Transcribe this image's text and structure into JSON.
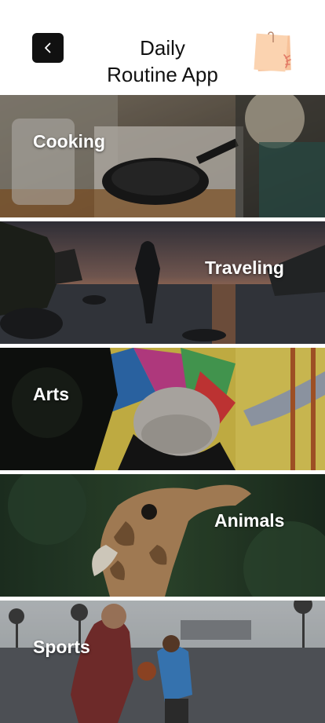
{
  "header": {
    "title_line1": "Daily",
    "title_line2": "Routine App",
    "back_icon": "chevron-left-icon",
    "note_icon": "sticky-note-icon"
  },
  "categories": [
    {
      "label": "Cooking",
      "image": "cooking-photo"
    },
    {
      "label": "Traveling",
      "image": "traveling-photo"
    },
    {
      "label": "Arts",
      "image": "arts-photo"
    },
    {
      "label": "Animals",
      "image": "animals-photo"
    },
    {
      "label": "Sports",
      "image": "sports-photo"
    }
  ]
}
